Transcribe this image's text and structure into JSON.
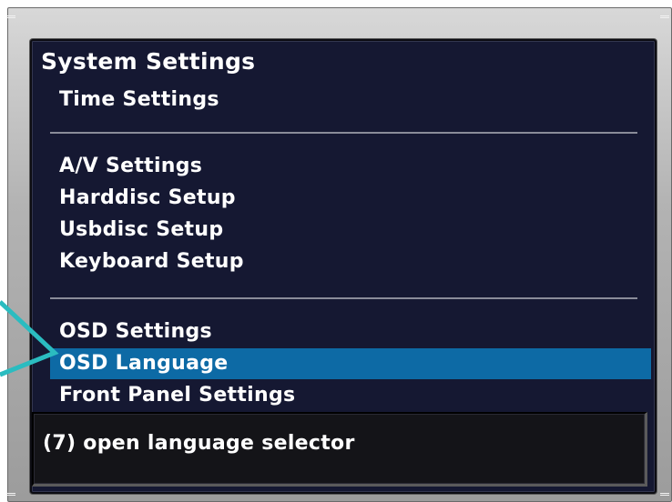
{
  "menu": {
    "title": "System Settings",
    "groups": [
      {
        "items": [
          "Time Settings"
        ]
      },
      {
        "items": [
          "A/V Settings",
          "Harddisc Setup",
          "Usbdisc Setup",
          "Keyboard Setup"
        ]
      },
      {
        "items": [
          "OSD Settings",
          "OSD Language",
          "Front Panel Settings"
        ]
      }
    ],
    "selected_item": "OSD Language"
  },
  "status": {
    "hint": "(7) open language selector"
  },
  "colors": {
    "screen_bg": "#151832",
    "selection": "#0d6aa5",
    "callout": "#2bbcc0",
    "text": "#ffffff"
  }
}
